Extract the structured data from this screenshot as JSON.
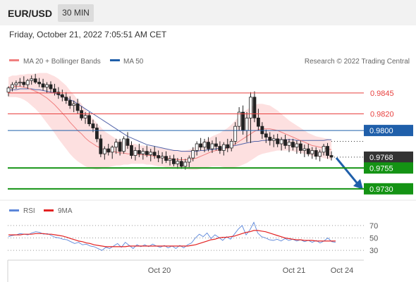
{
  "header": {
    "symbol": "EUR/USD",
    "timeframe": "30 MIN"
  },
  "datetime": "Friday, October 21, 2022 7:05:51 AM CET",
  "legend": {
    "ma_bb": "MA 20 + Bollinger Bands",
    "ma50": "MA 50",
    "rsi": "RSI",
    "rsi_ma": "9MA"
  },
  "credit": "Research © 2022 Trading Central",
  "colors": {
    "resistance": "#e8413f",
    "pivot": "#1f5faa",
    "support": "#149314",
    "bb_fill": "#fde0e0",
    "ma20": "#f08080",
    "ma50": "#5566aa",
    "rsi": "#5b86d9",
    "rsi_ma": "#e32222",
    "candle": "#222222",
    "arrow": "#1f5faa"
  },
  "chart_data": [
    {
      "type": "candlestick",
      "x_labels": [
        "Oct 20",
        "Oct 21",
        "Oct 24"
      ],
      "ylim": [
        0.9718,
        0.9872
      ],
      "price_levels": [
        {
          "label": "0.9845",
          "value": 0.9845,
          "kind": "resistance"
        },
        {
          "label": "0.9820",
          "value": 0.982,
          "kind": "resistance"
        },
        {
          "label": "0.9800",
          "value": 0.98,
          "kind": "pivot"
        },
        {
          "label": "0.9755",
          "value": 0.9755,
          "kind": "support"
        },
        {
          "label": "0.9730",
          "value": 0.973,
          "kind": "support"
        }
      ],
      "last_price": {
        "label": "0.9768",
        "value": 0.9768
      },
      "candles_ohlc": [
        [
          0.9846,
          0.9853,
          0.9841,
          0.9851
        ],
        [
          0.9851,
          0.9858,
          0.9847,
          0.9855
        ],
        [
          0.9855,
          0.986,
          0.985,
          0.9857
        ],
        [
          0.9857,
          0.9863,
          0.9853,
          0.9858
        ],
        [
          0.9858,
          0.9865,
          0.9852,
          0.9855
        ],
        [
          0.9855,
          0.9862,
          0.985,
          0.986
        ],
        [
          0.986,
          0.9866,
          0.9855,
          0.9862
        ],
        [
          0.9862,
          0.9868,
          0.9856,
          0.9858
        ],
        [
          0.9858,
          0.9863,
          0.9852,
          0.9856
        ],
        [
          0.9856,
          0.9862,
          0.9848,
          0.9852
        ],
        [
          0.9852,
          0.9858,
          0.9845,
          0.9855
        ],
        [
          0.9855,
          0.9859,
          0.9846,
          0.985
        ],
        [
          0.985,
          0.9856,
          0.9842,
          0.9846
        ],
        [
          0.9846,
          0.9852,
          0.9838,
          0.9843
        ],
        [
          0.9843,
          0.9849,
          0.9835,
          0.984
        ],
        [
          0.984,
          0.9846,
          0.9832,
          0.9836
        ],
        [
          0.9836,
          0.9841,
          0.9826,
          0.983
        ],
        [
          0.983,
          0.9836,
          0.9822,
          0.9832
        ],
        [
          0.9832,
          0.9838,
          0.982,
          0.9824
        ],
        [
          0.9824,
          0.9829,
          0.9812,
          0.9815
        ],
        [
          0.9815,
          0.9822,
          0.9808,
          0.9818
        ],
        [
          0.9818,
          0.9822,
          0.9805,
          0.9808
        ],
        [
          0.9808,
          0.9813,
          0.9798,
          0.9803
        ],
        [
          0.9803,
          0.9808,
          0.9786,
          0.979
        ],
        [
          0.979,
          0.9795,
          0.9768,
          0.9772
        ],
        [
          0.9772,
          0.9781,
          0.9765,
          0.9778
        ],
        [
          0.9778,
          0.9784,
          0.977,
          0.9774
        ],
        [
          0.9774,
          0.9782,
          0.9766,
          0.978
        ],
        [
          0.978,
          0.979,
          0.9772,
          0.9786
        ],
        [
          0.9786,
          0.979,
          0.977,
          0.9775
        ],
        [
          0.9775,
          0.9793,
          0.9772,
          0.979
        ],
        [
          0.979,
          0.9798,
          0.9778,
          0.9782
        ],
        [
          0.9782,
          0.9787,
          0.9766,
          0.977
        ],
        [
          0.977,
          0.978,
          0.9764,
          0.9776
        ],
        [
          0.9776,
          0.9784,
          0.9768,
          0.9772
        ],
        [
          0.9772,
          0.9779,
          0.9765,
          0.9775
        ],
        [
          0.9775,
          0.9782,
          0.9768,
          0.9771
        ],
        [
          0.9771,
          0.9778,
          0.9763,
          0.9774
        ],
        [
          0.9774,
          0.9781,
          0.9766,
          0.977
        ],
        [
          0.977,
          0.9776,
          0.9762,
          0.9767
        ],
        [
          0.9767,
          0.9774,
          0.976,
          0.9769
        ],
        [
          0.9769,
          0.9775,
          0.9761,
          0.9764
        ],
        [
          0.9764,
          0.977,
          0.9758,
          0.9766
        ],
        [
          0.9766,
          0.9771,
          0.9757,
          0.976
        ],
        [
          0.976,
          0.9767,
          0.9754,
          0.9763
        ],
        [
          0.9763,
          0.9768,
          0.9754,
          0.9757
        ],
        [
          0.9757,
          0.9766,
          0.9753,
          0.9762
        ],
        [
          0.9762,
          0.977,
          0.9756,
          0.9767
        ],
        [
          0.9767,
          0.978,
          0.9763,
          0.9776
        ],
        [
          0.9776,
          0.9787,
          0.977,
          0.9784
        ],
        [
          0.9784,
          0.9791,
          0.9776,
          0.978
        ],
        [
          0.978,
          0.979,
          0.9774,
          0.9786
        ],
        [
          0.9786,
          0.9792,
          0.9775,
          0.9778
        ],
        [
          0.9778,
          0.9788,
          0.9773,
          0.9784
        ],
        [
          0.9784,
          0.9792,
          0.9776,
          0.9781
        ],
        [
          0.9781,
          0.9787,
          0.9772,
          0.9776
        ],
        [
          0.9776,
          0.9786,
          0.977,
          0.9783
        ],
        [
          0.9783,
          0.979,
          0.9774,
          0.9779
        ],
        [
          0.9779,
          0.979,
          0.9775,
          0.9787
        ],
        [
          0.9787,
          0.981,
          0.9783,
          0.9805
        ],
        [
          0.9805,
          0.9828,
          0.98,
          0.9822
        ],
        [
          0.9822,
          0.983,
          0.9795,
          0.98
        ],
        [
          0.98,
          0.9822,
          0.9786,
          0.9815
        ],
        [
          0.9815,
          0.9846,
          0.9785,
          0.984
        ],
        [
          0.984,
          0.9847,
          0.981,
          0.9815
        ],
        [
          0.9815,
          0.9826,
          0.98,
          0.9805
        ],
        [
          0.9805,
          0.981,
          0.979,
          0.9796
        ],
        [
          0.9796,
          0.9801,
          0.9785,
          0.9792
        ],
        [
          0.9792,
          0.9798,
          0.9782,
          0.9788
        ],
        [
          0.9788,
          0.9795,
          0.978,
          0.979
        ],
        [
          0.979,
          0.9796,
          0.978,
          0.9784
        ],
        [
          0.9784,
          0.9792,
          0.9776,
          0.9789
        ],
        [
          0.9789,
          0.9795,
          0.9778,
          0.9782
        ],
        [
          0.9782,
          0.979,
          0.9774,
          0.9786
        ],
        [
          0.9786,
          0.979,
          0.9776,
          0.978
        ],
        [
          0.978,
          0.9788,
          0.9772,
          0.9784
        ],
        [
          0.9784,
          0.9788,
          0.9772,
          0.9776
        ],
        [
          0.9776,
          0.9783,
          0.9768,
          0.9778
        ],
        [
          0.9778,
          0.9784,
          0.9769,
          0.9772
        ],
        [
          0.9772,
          0.978,
          0.9766,
          0.9776
        ],
        [
          0.9776,
          0.978,
          0.9765,
          0.9769
        ],
        [
          0.9769,
          0.9777,
          0.9763,
          0.9774
        ],
        [
          0.9774,
          0.9784,
          0.977,
          0.9781
        ],
        [
          0.9781,
          0.9785,
          0.9766,
          0.977
        ],
        [
          0.977,
          0.9775,
          0.9764,
          0.9768
        ]
      ],
      "ma20": [
        0.9852,
        0.9853,
        0.9853,
        0.9853,
        0.9852,
        0.9851,
        0.9849,
        0.9847,
        0.9845,
        0.9842,
        0.9839,
        0.9835,
        0.9831,
        0.9826,
        0.9821,
        0.9816,
        0.981,
        0.9805,
        0.98,
        0.9796,
        0.9791,
        0.9787,
        0.9784,
        0.9781,
        0.9779,
        0.9777,
        0.9776,
        0.9775,
        0.9774,
        0.9773,
        0.9773,
        0.9772,
        0.9772,
        0.9772,
        0.9771,
        0.9771,
        0.977,
        0.977,
        0.9769,
        0.9768,
        0.9768,
        0.9767,
        0.9766,
        0.9766,
        0.9765,
        0.9765,
        0.9765,
        0.9765,
        0.9766,
        0.9767,
        0.9769,
        0.9771,
        0.9773,
        0.9775,
        0.9776,
        0.9777,
        0.9778,
        0.9779,
        0.9781,
        0.9784,
        0.9787,
        0.979,
        0.9793,
        0.9796,
        0.9799,
        0.9801,
        0.9802,
        0.9802,
        0.9802,
        0.9801,
        0.98,
        0.9798,
        0.9796,
        0.9794,
        0.9792,
        0.979,
        0.9788,
        0.9786,
        0.9784,
        0.9782,
        0.9781,
        0.978,
        0.9779,
        0.9778,
        0.9777
      ],
      "bb_width": [
        0.0012,
        0.0013,
        0.0013,
        0.0014,
        0.0015,
        0.0017,
        0.0019,
        0.0021,
        0.0024,
        0.0027,
        0.003,
        0.0032,
        0.0034,
        0.0036,
        0.0037,
        0.0038,
        0.0038,
        0.0038,
        0.0037,
        0.0036,
        0.0034,
        0.0032,
        0.003,
        0.0028,
        0.0025,
        0.0022,
        0.002,
        0.0018,
        0.0016,
        0.0015,
        0.0014,
        0.0013,
        0.0012,
        0.0012,
        0.0011,
        0.0011,
        0.0011,
        0.0011,
        0.0011,
        0.0011,
        0.0011,
        0.0011,
        0.0011,
        0.0011,
        0.0011,
        0.0011,
        0.0011,
        0.0012,
        0.0013,
        0.0014,
        0.0015,
        0.0016,
        0.0017,
        0.0018,
        0.0019,
        0.002,
        0.0022,
        0.0024,
        0.0026,
        0.0028,
        0.003,
        0.0031,
        0.0032,
        0.0032,
        0.0032,
        0.0031,
        0.003,
        0.0029,
        0.0028,
        0.0026,
        0.0024,
        0.0022,
        0.002,
        0.0018,
        0.0017,
        0.0016,
        0.0015,
        0.0014,
        0.0013,
        0.0013,
        0.0012,
        0.0012,
        0.0012,
        0.0012,
        0.0012
      ],
      "ma50": [
        0.9848,
        0.9849,
        0.9849,
        0.985,
        0.985,
        0.985,
        0.985,
        0.9849,
        0.9849,
        0.9848,
        0.9847,
        0.9846,
        0.9845,
        0.9843,
        0.9841,
        0.9839,
        0.9837,
        0.9835,
        0.9832,
        0.9829,
        0.9826,
        0.9823,
        0.982,
        0.9817,
        0.9814,
        0.9811,
        0.9808,
        0.9805,
        0.9802,
        0.9799,
        0.9796,
        0.9793,
        0.9791,
        0.9789,
        0.9787,
        0.9785,
        0.9783,
        0.9782,
        0.9781,
        0.978,
        0.9779,
        0.9778,
        0.9777,
        0.9776,
        0.9776,
        0.9775,
        0.9775,
        0.9775,
        0.9775,
        0.9775,
        0.9776,
        0.9776,
        0.9777,
        0.9777,
        0.9778,
        0.9779,
        0.9779,
        0.978,
        0.9781,
        0.9782,
        0.9783,
        0.9784,
        0.9785,
        0.9786,
        0.9787,
        0.9787,
        0.9788,
        0.9788,
        0.9789,
        0.9789,
        0.9789,
        0.9789,
        0.9789,
        0.9789,
        0.9789,
        0.9788,
        0.9788,
        0.9788,
        0.9788,
        0.9788,
        0.9788,
        0.9788,
        0.9788,
        0.9789,
        0.9789
      ]
    },
    {
      "type": "line",
      "ylim": [
        20,
        80
      ],
      "y_ticks": [
        {
          "label": "70",
          "value": 70
        },
        {
          "label": "50",
          "value": 50
        },
        {
          "label": "30",
          "value": 30
        }
      ],
      "series": [
        {
          "name": "RSI",
          "values": [
            52,
            54,
            55,
            57,
            56,
            55,
            58,
            60,
            59,
            56,
            57,
            54,
            51,
            50,
            48,
            47,
            44,
            41,
            43,
            39,
            40,
            37,
            36,
            33,
            30,
            35,
            33,
            37,
            41,
            35,
            43,
            38,
            33,
            39,
            36,
            39,
            36,
            40,
            37,
            35,
            38,
            34,
            37,
            33,
            38,
            34,
            39,
            42,
            50,
            56,
            52,
            58,
            49,
            55,
            51,
            46,
            52,
            48,
            56,
            64,
            70,
            55,
            63,
            75,
            58,
            52,
            50,
            47,
            46,
            48,
            45,
            49,
            46,
            48,
            45,
            47,
            44,
            46,
            43,
            46,
            42,
            45,
            50,
            44,
            43
          ]
        },
        {
          "name": "9MA",
          "values": [
            55,
            55,
            55,
            55,
            56,
            56,
            56,
            57,
            57,
            57,
            56,
            56,
            55,
            54,
            53,
            51,
            49,
            47,
            45,
            44,
            42,
            41,
            39,
            38,
            37,
            36,
            36,
            36,
            36,
            36,
            36,
            37,
            37,
            37,
            37,
            37,
            37,
            37,
            37,
            37,
            37,
            37,
            37,
            37,
            37,
            37,
            37,
            38,
            39,
            41,
            43,
            45,
            47,
            48,
            50,
            51,
            51,
            52,
            53,
            55,
            57,
            59,
            60,
            62,
            62,
            61,
            60,
            58,
            56,
            54,
            52,
            50,
            49,
            48,
            47,
            47,
            46,
            46,
            46,
            45,
            45,
            45,
            45,
            45,
            45
          ]
        }
      ],
      "x_labels": [
        "Oct 20",
        "Oct 21",
        "Oct 24"
      ]
    }
  ]
}
